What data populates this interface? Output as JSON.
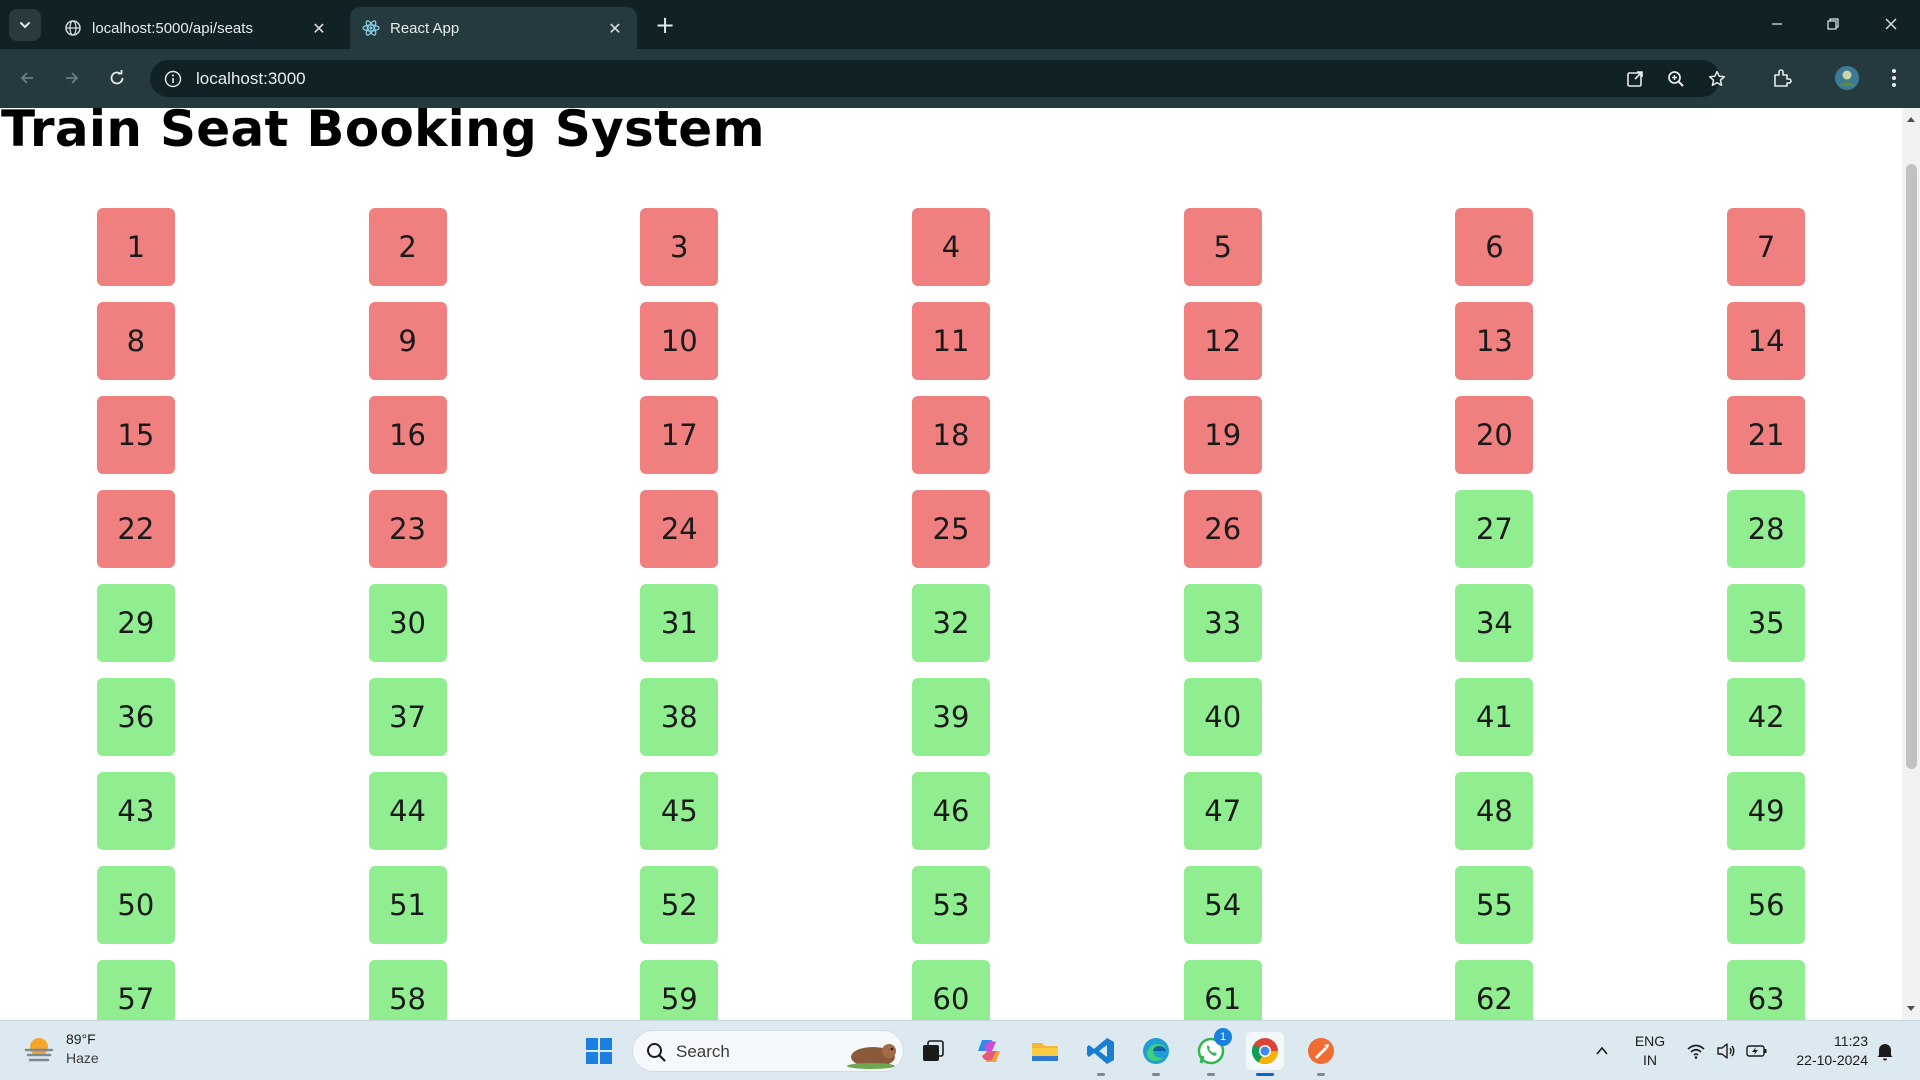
{
  "browser": {
    "tabs": [
      {
        "title": "localhost:5000/api/seats",
        "icon": "globe-icon",
        "active": false
      },
      {
        "title": "React App",
        "icon": "react-icon",
        "active": true
      }
    ],
    "new_tab_label": "+",
    "address": "localhost:3000"
  },
  "page": {
    "title": "Train Seat Booking System",
    "seats": [
      {
        "number": "1",
        "status": "booked"
      },
      {
        "number": "2",
        "status": "booked"
      },
      {
        "number": "3",
        "status": "booked"
      },
      {
        "number": "4",
        "status": "booked"
      },
      {
        "number": "5",
        "status": "booked"
      },
      {
        "number": "6",
        "status": "booked"
      },
      {
        "number": "7",
        "status": "booked"
      },
      {
        "number": "8",
        "status": "booked"
      },
      {
        "number": "9",
        "status": "booked"
      },
      {
        "number": "10",
        "status": "booked"
      },
      {
        "number": "11",
        "status": "booked"
      },
      {
        "number": "12",
        "status": "booked"
      },
      {
        "number": "13",
        "status": "booked"
      },
      {
        "number": "14",
        "status": "booked"
      },
      {
        "number": "15",
        "status": "booked"
      },
      {
        "number": "16",
        "status": "booked"
      },
      {
        "number": "17",
        "status": "booked"
      },
      {
        "number": "18",
        "status": "booked"
      },
      {
        "number": "19",
        "status": "booked"
      },
      {
        "number": "20",
        "status": "booked"
      },
      {
        "number": "21",
        "status": "booked"
      },
      {
        "number": "22",
        "status": "booked"
      },
      {
        "number": "23",
        "status": "booked"
      },
      {
        "number": "24",
        "status": "booked"
      },
      {
        "number": "25",
        "status": "booked"
      },
      {
        "number": "26",
        "status": "booked"
      },
      {
        "number": "27",
        "status": "available"
      },
      {
        "number": "28",
        "status": "available"
      },
      {
        "number": "29",
        "status": "available"
      },
      {
        "number": "30",
        "status": "available"
      },
      {
        "number": "31",
        "status": "available"
      },
      {
        "number": "32",
        "status": "available"
      },
      {
        "number": "33",
        "status": "available"
      },
      {
        "number": "34",
        "status": "available"
      },
      {
        "number": "35",
        "status": "available"
      },
      {
        "number": "36",
        "status": "available"
      },
      {
        "number": "37",
        "status": "available"
      },
      {
        "number": "38",
        "status": "available"
      },
      {
        "number": "39",
        "status": "available"
      },
      {
        "number": "40",
        "status": "available"
      },
      {
        "number": "41",
        "status": "available"
      },
      {
        "number": "42",
        "status": "available"
      },
      {
        "number": "43",
        "status": "available"
      },
      {
        "number": "44",
        "status": "available"
      },
      {
        "number": "45",
        "status": "available"
      },
      {
        "number": "46",
        "status": "available"
      },
      {
        "number": "47",
        "status": "available"
      },
      {
        "number": "48",
        "status": "available"
      },
      {
        "number": "49",
        "status": "available"
      },
      {
        "number": "50",
        "status": "available"
      },
      {
        "number": "51",
        "status": "available"
      },
      {
        "number": "52",
        "status": "available"
      },
      {
        "number": "53",
        "status": "available"
      },
      {
        "number": "54",
        "status": "available"
      },
      {
        "number": "55",
        "status": "available"
      },
      {
        "number": "56",
        "status": "available"
      },
      {
        "number": "57",
        "status": "available"
      },
      {
        "number": "58",
        "status": "available"
      },
      {
        "number": "59",
        "status": "available"
      },
      {
        "number": "60",
        "status": "available"
      },
      {
        "number": "61",
        "status": "available"
      },
      {
        "number": "62",
        "status": "available"
      },
      {
        "number": "63",
        "status": "available"
      }
    ]
  },
  "colors": {
    "booked": "#f08080",
    "available": "#90ee90",
    "chrome_dark": "#102226",
    "chrome_toolbar": "#243a3e"
  },
  "taskbar": {
    "weather": {
      "temp": "89°F",
      "condition": "Haze"
    },
    "search_label": "Search",
    "apps": [
      "start-icon",
      "search-icon",
      "task-view-icon",
      "copilot-icon",
      "file-explorer-icon",
      "vscode-icon",
      "edge-icon",
      "whatsapp-icon",
      "chrome-icon",
      "postman-icon"
    ],
    "whatsapp_badge": "1",
    "language": {
      "line1": "ENG",
      "line2": "IN"
    },
    "clock": {
      "time": "11:23",
      "date": "22-10-2024"
    }
  }
}
